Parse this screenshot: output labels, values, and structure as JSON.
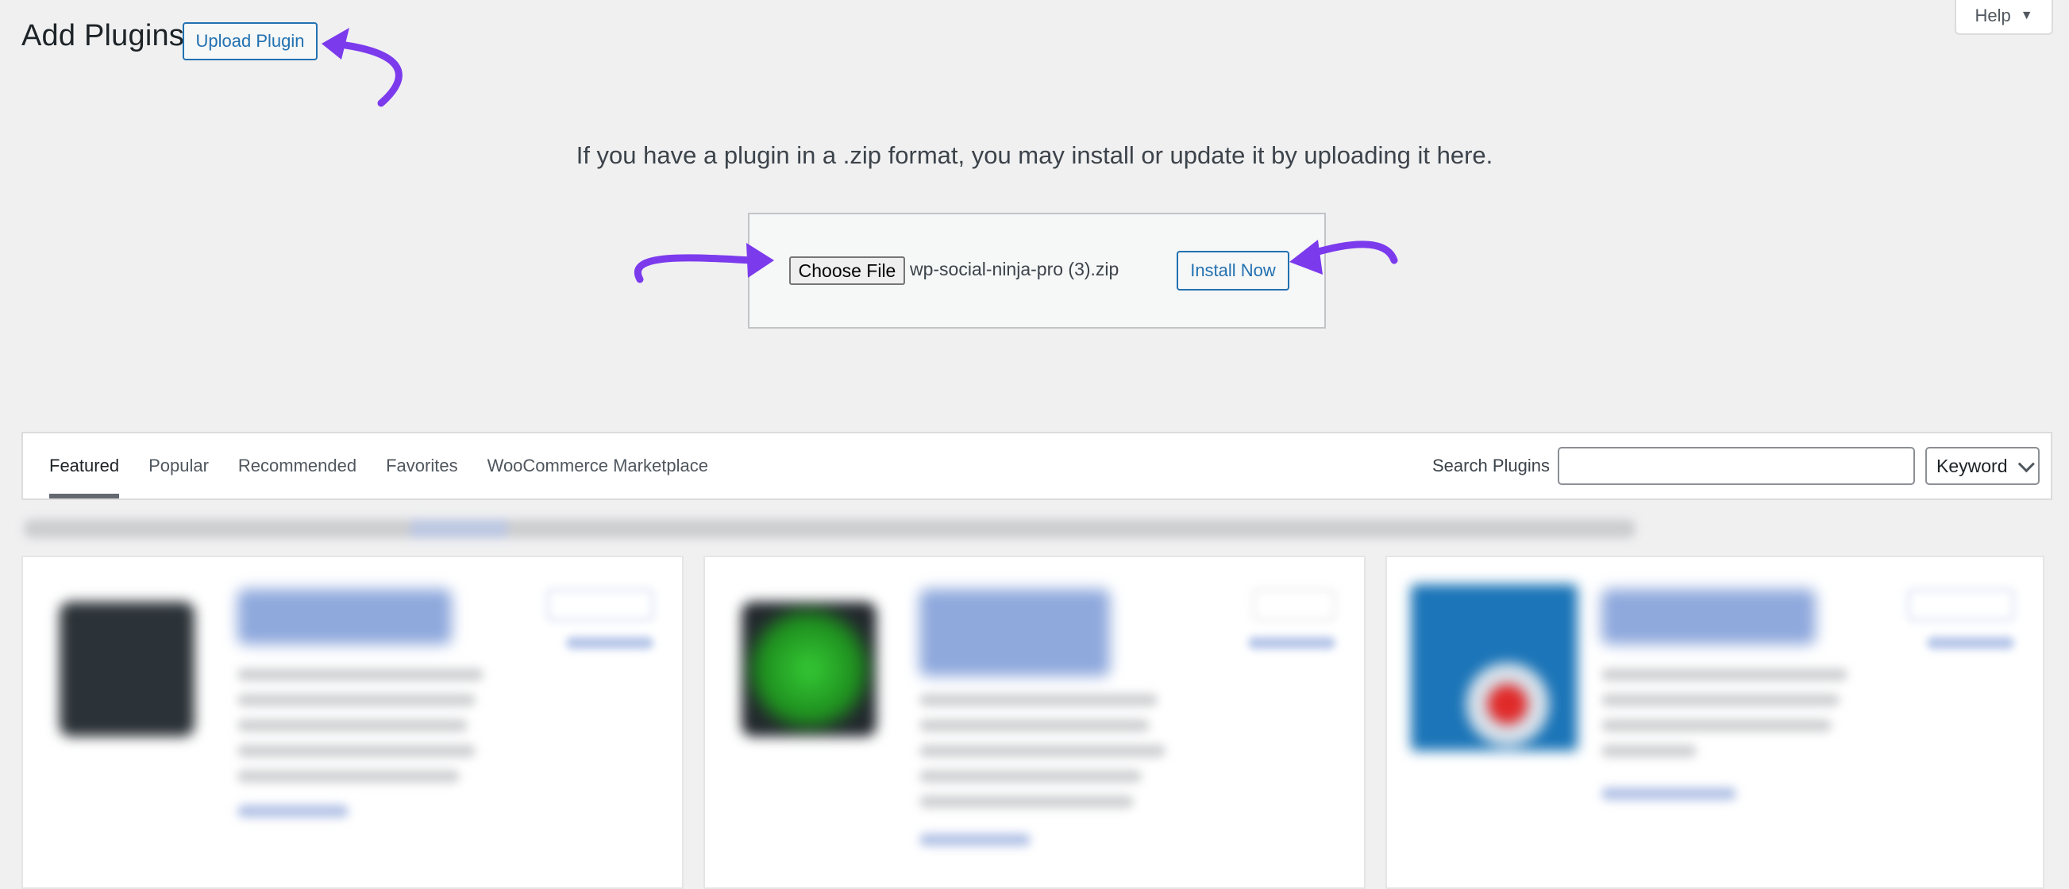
{
  "header": {
    "title": "Add Plugins",
    "upload_button": "Upload Plugin",
    "help_button": "Help",
    "help_caret": "▼"
  },
  "upload": {
    "description": "If you have a plugin in a .zip format, you may install or update it by uploading it here.",
    "choose_file_label": "Choose File",
    "file_name": "wp-social-ninja-pro (3).zip",
    "install_button": "Install Now"
  },
  "filters": {
    "tabs": [
      {
        "label": "Featured",
        "active": true
      },
      {
        "label": "Popular",
        "active": false
      },
      {
        "label": "Recommended",
        "active": false
      },
      {
        "label": "Favorites",
        "active": false
      },
      {
        "label": "WooCommerce Marketplace",
        "active": false
      }
    ],
    "search_label": "Search Plugins",
    "search_value": "",
    "search_type": "Keyword"
  },
  "annotations": {
    "arrow_color": "#7c3aed"
  },
  "colors": {
    "accent": "#2271b1",
    "background": "#f0f0f1"
  }
}
